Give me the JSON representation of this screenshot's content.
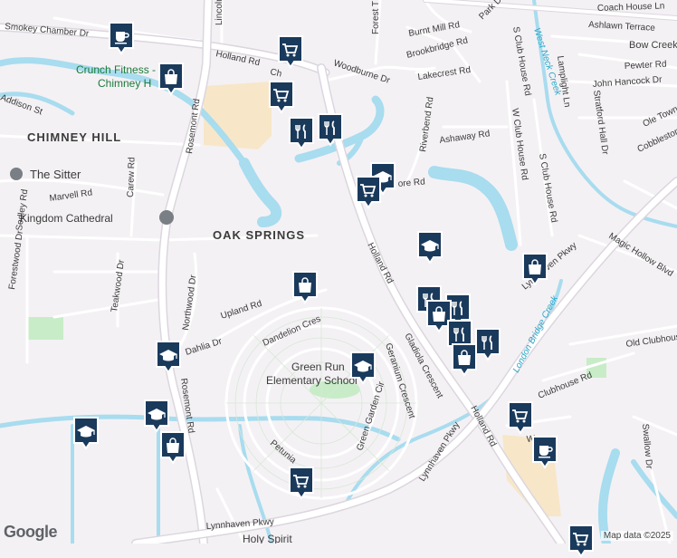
{
  "colors": {
    "background": "#f4f1f4",
    "water": "#a8dcef",
    "road": "#ffffff",
    "road_outline": "#e2dde3",
    "major_road": "#dcd6de",
    "park": "#c8ecc8",
    "commercial": "#f7e7c8",
    "pin_fill": "#1a3a5c",
    "pin_border": "#ffffff",
    "poi_text": "#1a7a3a"
  },
  "areas": {
    "chimney_hill": "CHIMNEY HILL",
    "oak_springs": "OAK SPRINGS"
  },
  "places": {
    "crunch_line1": "Crunch Fitness -",
    "crunch_line2": "Chimney H",
    "the_sitter": "The Sitter",
    "kingdom_cathedral": "Kingdom Cathedral",
    "green_run_line1": "Green Run",
    "green_run_line2": "Elementary School",
    "holy_spirit": "Holy Spirit"
  },
  "streets": {
    "holland_rd_top": "Holland Rd",
    "holland_rd_mid": "Holland Rd",
    "holland_rd_bottom": "Holland Rd",
    "rosemont_rd_top": "Rosemont Rd",
    "rosemont_rd_bottom": "Rosemont Rd",
    "smokey_chamber": "Smokey Chamber Dr",
    "lincoln": "Lincoln",
    "addison": "Addison St",
    "marvell": "Marvell Rd",
    "carew": "Carew Rd",
    "sedley": "Sedley Rd",
    "forestwood": "Forestwood Dr",
    "teakwood": "Teakwood Dr",
    "northwood": "Northwood Dr",
    "upland": "Upland Rd",
    "dahlia": "Dahlia Dr",
    "dandelion": "Dandelion Cres",
    "gladiola": "Gladiola Crescent",
    "geranium": "Geranium Crescent",
    "green_garden": "Green Garden Cir",
    "petunia": "Petunia",
    "lynnhaven_bottom": "Lynnhaven Pkwy",
    "lynnhaven_mid": "Lynnhaven Pkwy",
    "lynnhaven_right": "Lynnhaven Pkwy",
    "woodburne": "Woodburne Dr",
    "forest_t": "Forest T",
    "burnt_mill": "Burnt Mill Rd",
    "brookbridge": "Brookbridge Rd",
    "lakecrest": "Lakecrest Rd",
    "riverbend": "Riverbend Rd",
    "ashaway": "Ashaway Rd",
    "park_dr": "Park Dr",
    "w_club_house": "W Club House Rd",
    "s_club_house": "S Club House Rd",
    "w_clubhouse": "W Clubhouse Rd",
    "s_club_house_2": "S Club House Rd",
    "lamplight": "Lamplight Ln",
    "coach_house": "Coach House Ln",
    "ashlawn": "Ashlawn Terrace",
    "bow_creek": "Bow Creek",
    "pewter": "Pewter Rd",
    "john_hancock": "John Hancock Dr",
    "stratford_hall": "Stratford Hall Dr",
    "ole_town": "Ole Town",
    "cobblestone": "Cobblestone",
    "magic_hollow": "Magic Hollow Blvd",
    "old_clubhouse": "Old Clubhouse",
    "clubhouse_rd": "Clubhouse Rd",
    "swallow": "Swallow Dr",
    "ware": "War",
    "ore_rd": "ore Rd",
    "ch_label": "Ch"
  },
  "water_labels": {
    "west_neck_creek": "West Neck Creek",
    "london_bridge_creek": "London Bridge Creek"
  },
  "footer": {
    "logo": "Google",
    "attribution": "Map data ©2025"
  },
  "pins": [
    {
      "id": "cafe-1",
      "icon": "coffee-icon",
      "label": "Cafe"
    },
    {
      "id": "shopping-1",
      "icon": "shopping-bag-icon",
      "label": "Store"
    },
    {
      "id": "grocery-1",
      "icon": "shopping-cart-icon",
      "label": "Grocery"
    },
    {
      "id": "grocery-2",
      "icon": "shopping-cart-icon",
      "label": "Grocery"
    },
    {
      "id": "restaurant-1",
      "icon": "restaurant-icon",
      "label": "Restaurant"
    },
    {
      "id": "restaurant-2",
      "icon": "restaurant-icon",
      "label": "Restaurant"
    },
    {
      "id": "school-1",
      "icon": "school-icon",
      "label": "School"
    },
    {
      "id": "grocery-3",
      "icon": "shopping-cart-icon",
      "label": "Grocery"
    },
    {
      "id": "school-2",
      "icon": "school-icon",
      "label": "School"
    },
    {
      "id": "shopping-2",
      "icon": "shopping-bag-icon",
      "label": "Store"
    },
    {
      "id": "shopping-3",
      "icon": "shopping-bag-icon",
      "label": "Store"
    },
    {
      "id": "restaurant-3",
      "icon": "restaurant-icon",
      "label": "Restaurant"
    },
    {
      "id": "restaurant-4",
      "icon": "restaurant-icon",
      "label": "Restaurant"
    },
    {
      "id": "shopping-4",
      "icon": "shopping-bag-icon",
      "label": "Store"
    },
    {
      "id": "restaurant-5",
      "icon": "restaurant-icon",
      "label": "Restaurant"
    },
    {
      "id": "restaurant-6",
      "icon": "restaurant-icon",
      "label": "Restaurant"
    },
    {
      "id": "shopping-5",
      "icon": "shopping-bag-icon",
      "label": "Store"
    },
    {
      "id": "school-3",
      "icon": "school-icon",
      "label": "School"
    },
    {
      "id": "school-4",
      "icon": "school-icon",
      "label": "School"
    },
    {
      "id": "school-5",
      "icon": "school-icon",
      "label": "School"
    },
    {
      "id": "school-6",
      "icon": "school-icon",
      "label": "School"
    },
    {
      "id": "shopping-6",
      "icon": "shopping-bag-icon",
      "label": "Store"
    },
    {
      "id": "grocery-4",
      "icon": "shopping-cart-icon",
      "label": "Grocery"
    },
    {
      "id": "cafe-2",
      "icon": "coffee-icon",
      "label": "Cafe"
    },
    {
      "id": "grocery-5",
      "icon": "shopping-cart-icon",
      "label": "Grocery"
    },
    {
      "id": "grocery-6",
      "icon": "shopping-cart-icon",
      "label": "Grocery"
    }
  ]
}
